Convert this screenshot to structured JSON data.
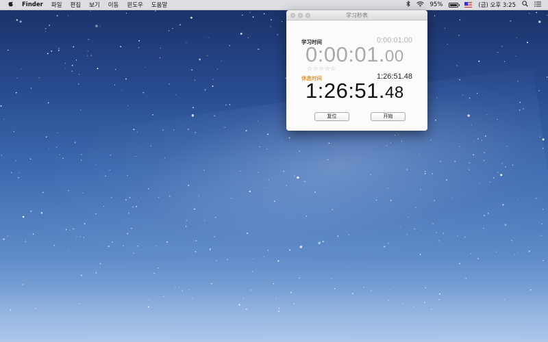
{
  "menubar": {
    "apple_icon": "apple-logo-icon",
    "items": [
      "Finder",
      "파일",
      "편집",
      "보기",
      "이동",
      "윈도우",
      "도움말"
    ],
    "battery_percent": "95%",
    "battery_level": 0.95,
    "clock": "(금) 오후 3:25"
  },
  "window": {
    "title": "学习秒表",
    "study": {
      "label": "学习时间",
      "small_time": "0:00:01.00",
      "big_main": "0:00:01.",
      "big_ms": "00",
      "rating_stars": "☆☆☆☆☆"
    },
    "break": {
      "label": "休息时间",
      "small_time": "1:26:51.48",
      "big_main": "1:26:51.",
      "big_ms": "48"
    },
    "buttons": {
      "reset": "复位",
      "start": "开始"
    }
  },
  "colors": {
    "break_label": "#f0941c",
    "desktop_top": "#1b2f66",
    "desktop_bottom": "#9fbde6"
  }
}
